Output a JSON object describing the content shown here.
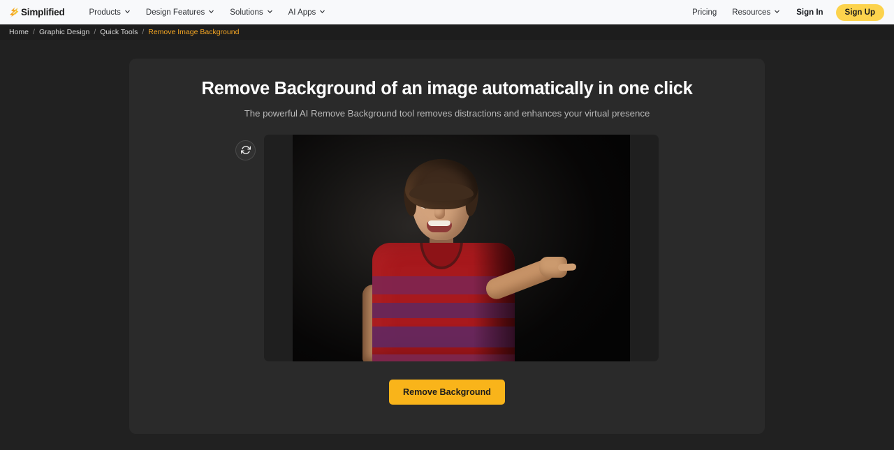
{
  "navbar": {
    "brand": {
      "name": "Simplified",
      "logo_icon": "simplified-bolt-logo"
    },
    "links": [
      {
        "label": "Products",
        "has_dropdown": true
      },
      {
        "label": "Design Features",
        "has_dropdown": true
      },
      {
        "label": "Solutions",
        "has_dropdown": true
      },
      {
        "label": "AI Apps",
        "has_dropdown": true
      }
    ],
    "right_links": [
      {
        "label": "Pricing",
        "has_dropdown": false
      },
      {
        "label": "Resources",
        "has_dropdown": true
      }
    ],
    "sign_in_label": "Sign In",
    "sign_up_label": "Sign Up",
    "background": "#f8f9fb",
    "signup_color": "#fcd34d"
  },
  "breadcrumb": {
    "separator": "/",
    "items": [
      {
        "label": "Home",
        "current": false
      },
      {
        "label": "Graphic Design",
        "current": false
      },
      {
        "label": "Quick Tools",
        "current": false
      },
      {
        "label": "Remove Image Background",
        "current": true
      }
    ],
    "current_color": "#f5a623",
    "background": "#1d1d1d"
  },
  "main": {
    "headline": "Remove Background of an image automatically in one click",
    "subheadline": "The powerful AI Remove Background tool removes distractions and enhances your virtual presence",
    "card_background": "#2a2a2a",
    "page_background": "#212121",
    "reset_button": {
      "icon": "refresh-icon",
      "label": ""
    },
    "preview": {
      "alt": "Smiling young boy in a red striped t-shirt pointing to his right against a dark studio backdrop",
      "canvas_background": "#1f1f1f"
    },
    "cta": {
      "label": "Remove Background",
      "color": "#f9b41a",
      "text_color": "#1b1b1b"
    }
  }
}
